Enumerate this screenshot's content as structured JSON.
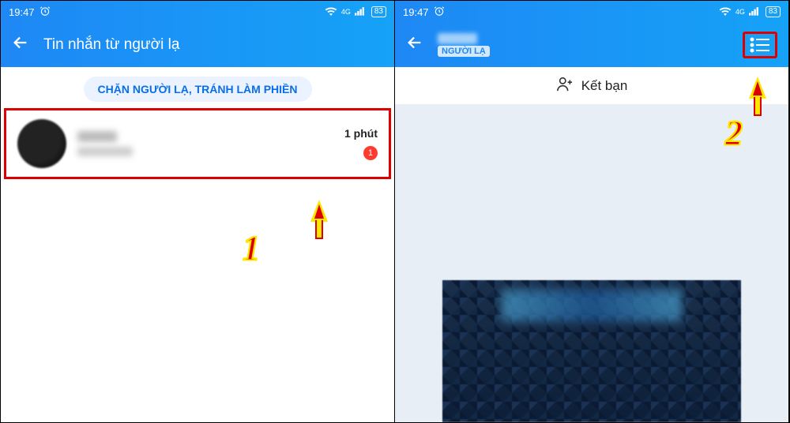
{
  "status": {
    "time": "19:47",
    "network": "4G",
    "battery": "83"
  },
  "left": {
    "header_title": "Tin nhắn từ người lạ",
    "block_pill": "CHẶN NGƯỜI LẠ, TRÁNH LÀM PHIỀN",
    "convo": {
      "time": "1 phút",
      "unread": "1"
    },
    "annotation": "1"
  },
  "right": {
    "stranger_badge": "NGƯỜI LẠ",
    "friend_button": "Kết bạn",
    "annotation": "2"
  }
}
